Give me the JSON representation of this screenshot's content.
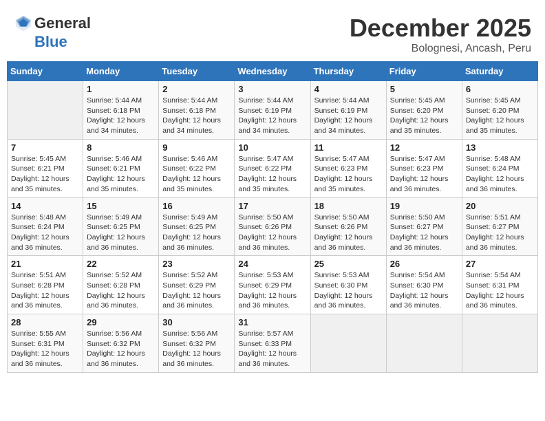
{
  "header": {
    "logo_line1": "General",
    "logo_line2": "Blue",
    "month": "December 2025",
    "location": "Bolognesi, Ancash, Peru"
  },
  "weekdays": [
    "Sunday",
    "Monday",
    "Tuesday",
    "Wednesday",
    "Thursday",
    "Friday",
    "Saturday"
  ],
  "weeks": [
    [
      {
        "day": "",
        "info": ""
      },
      {
        "day": "1",
        "info": "Sunrise: 5:44 AM\nSunset: 6:18 PM\nDaylight: 12 hours\nand 34 minutes."
      },
      {
        "day": "2",
        "info": "Sunrise: 5:44 AM\nSunset: 6:18 PM\nDaylight: 12 hours\nand 34 minutes."
      },
      {
        "day": "3",
        "info": "Sunrise: 5:44 AM\nSunset: 6:19 PM\nDaylight: 12 hours\nand 34 minutes."
      },
      {
        "day": "4",
        "info": "Sunrise: 5:44 AM\nSunset: 6:19 PM\nDaylight: 12 hours\nand 34 minutes."
      },
      {
        "day": "5",
        "info": "Sunrise: 5:45 AM\nSunset: 6:20 PM\nDaylight: 12 hours\nand 35 minutes."
      },
      {
        "day": "6",
        "info": "Sunrise: 5:45 AM\nSunset: 6:20 PM\nDaylight: 12 hours\nand 35 minutes."
      }
    ],
    [
      {
        "day": "7",
        "info": "Sunrise: 5:45 AM\nSunset: 6:21 PM\nDaylight: 12 hours\nand 35 minutes."
      },
      {
        "day": "8",
        "info": "Sunrise: 5:46 AM\nSunset: 6:21 PM\nDaylight: 12 hours\nand 35 minutes."
      },
      {
        "day": "9",
        "info": "Sunrise: 5:46 AM\nSunset: 6:22 PM\nDaylight: 12 hours\nand 35 minutes."
      },
      {
        "day": "10",
        "info": "Sunrise: 5:47 AM\nSunset: 6:22 PM\nDaylight: 12 hours\nand 35 minutes."
      },
      {
        "day": "11",
        "info": "Sunrise: 5:47 AM\nSunset: 6:23 PM\nDaylight: 12 hours\nand 35 minutes."
      },
      {
        "day": "12",
        "info": "Sunrise: 5:47 AM\nSunset: 6:23 PM\nDaylight: 12 hours\nand 36 minutes."
      },
      {
        "day": "13",
        "info": "Sunrise: 5:48 AM\nSunset: 6:24 PM\nDaylight: 12 hours\nand 36 minutes."
      }
    ],
    [
      {
        "day": "14",
        "info": "Sunrise: 5:48 AM\nSunset: 6:24 PM\nDaylight: 12 hours\nand 36 minutes."
      },
      {
        "day": "15",
        "info": "Sunrise: 5:49 AM\nSunset: 6:25 PM\nDaylight: 12 hours\nand 36 minutes."
      },
      {
        "day": "16",
        "info": "Sunrise: 5:49 AM\nSunset: 6:25 PM\nDaylight: 12 hours\nand 36 minutes."
      },
      {
        "day": "17",
        "info": "Sunrise: 5:50 AM\nSunset: 6:26 PM\nDaylight: 12 hours\nand 36 minutes."
      },
      {
        "day": "18",
        "info": "Sunrise: 5:50 AM\nSunset: 6:26 PM\nDaylight: 12 hours\nand 36 minutes."
      },
      {
        "day": "19",
        "info": "Sunrise: 5:50 AM\nSunset: 6:27 PM\nDaylight: 12 hours\nand 36 minutes."
      },
      {
        "day": "20",
        "info": "Sunrise: 5:51 AM\nSunset: 6:27 PM\nDaylight: 12 hours\nand 36 minutes."
      }
    ],
    [
      {
        "day": "21",
        "info": "Sunrise: 5:51 AM\nSunset: 6:28 PM\nDaylight: 12 hours\nand 36 minutes."
      },
      {
        "day": "22",
        "info": "Sunrise: 5:52 AM\nSunset: 6:28 PM\nDaylight: 12 hours\nand 36 minutes."
      },
      {
        "day": "23",
        "info": "Sunrise: 5:52 AM\nSunset: 6:29 PM\nDaylight: 12 hours\nand 36 minutes."
      },
      {
        "day": "24",
        "info": "Sunrise: 5:53 AM\nSunset: 6:29 PM\nDaylight: 12 hours\nand 36 minutes."
      },
      {
        "day": "25",
        "info": "Sunrise: 5:53 AM\nSunset: 6:30 PM\nDaylight: 12 hours\nand 36 minutes."
      },
      {
        "day": "26",
        "info": "Sunrise: 5:54 AM\nSunset: 6:30 PM\nDaylight: 12 hours\nand 36 minutes."
      },
      {
        "day": "27",
        "info": "Sunrise: 5:54 AM\nSunset: 6:31 PM\nDaylight: 12 hours\nand 36 minutes."
      }
    ],
    [
      {
        "day": "28",
        "info": "Sunrise: 5:55 AM\nSunset: 6:31 PM\nDaylight: 12 hours\nand 36 minutes."
      },
      {
        "day": "29",
        "info": "Sunrise: 5:56 AM\nSunset: 6:32 PM\nDaylight: 12 hours\nand 36 minutes."
      },
      {
        "day": "30",
        "info": "Sunrise: 5:56 AM\nSunset: 6:32 PM\nDaylight: 12 hours\nand 36 minutes."
      },
      {
        "day": "31",
        "info": "Sunrise: 5:57 AM\nSunset: 6:33 PM\nDaylight: 12 hours\nand 36 minutes."
      },
      {
        "day": "",
        "info": ""
      },
      {
        "day": "",
        "info": ""
      },
      {
        "day": "",
        "info": ""
      }
    ]
  ]
}
